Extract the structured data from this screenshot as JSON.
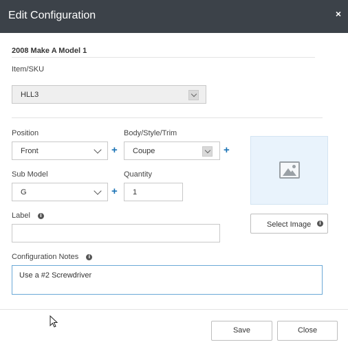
{
  "dialog": {
    "title": "Edit Configuration",
    "close_symbol": "×"
  },
  "product": {
    "title": "2008 Make A Model 1"
  },
  "item_sku": {
    "label": "Item/SKU",
    "value": "HLL3"
  },
  "position": {
    "label": "Position",
    "value": "Front"
  },
  "body_style_trim": {
    "label": "Body/Style/Trim",
    "value": "Coupe"
  },
  "sub_model": {
    "label": "Sub Model",
    "value": "G"
  },
  "quantity": {
    "label": "Quantity",
    "value": "1"
  },
  "label_field": {
    "label": "Label",
    "value": ""
  },
  "notes": {
    "label": "Configuration Notes",
    "value": "Use a #2 Screwdriver"
  },
  "image": {
    "select_label": "Select Image",
    "placeholder_icon": "image-icon"
  },
  "icons": {
    "add": "+",
    "info": "i"
  },
  "footer": {
    "save_label": "Save",
    "close_label": "Close"
  },
  "colors": {
    "header_bg": "#3c4249",
    "accent": "#1a73b5",
    "image_bg": "#e9f3fc"
  }
}
